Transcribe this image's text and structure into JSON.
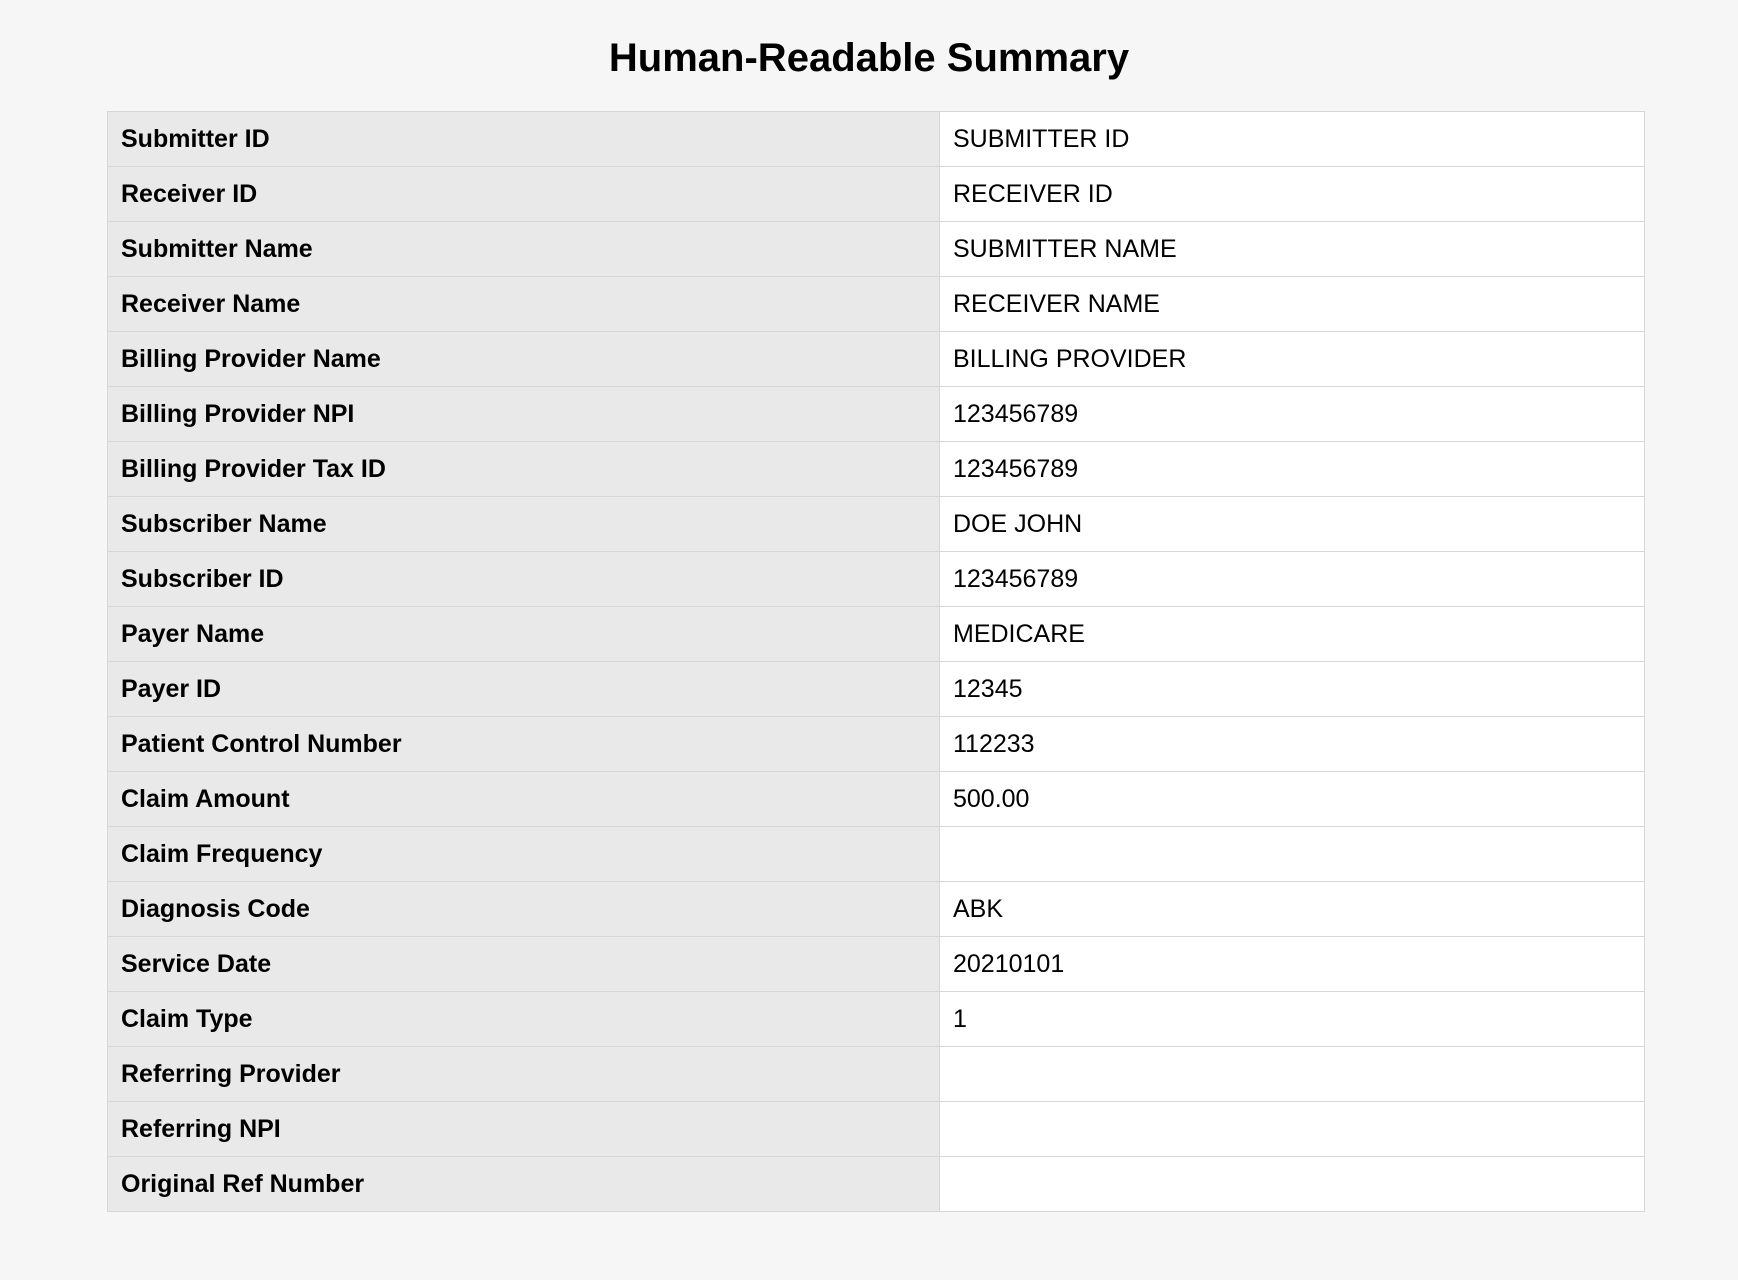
{
  "page": {
    "title": "Human-Readable Summary"
  },
  "colors": {
    "page_background": "#f6f6f6",
    "label_cell_background": "#e9e9e9",
    "value_cell_background": "#ffffff",
    "border": "#d6d6d6"
  },
  "summary": {
    "rows": [
      {
        "label": "Submitter ID",
        "value": "SUBMITTER ID"
      },
      {
        "label": "Receiver ID",
        "value": "RECEIVER ID"
      },
      {
        "label": "Submitter Name",
        "value": "SUBMITTER NAME"
      },
      {
        "label": "Receiver Name",
        "value": "RECEIVER NAME"
      },
      {
        "label": "Billing Provider Name",
        "value": "BILLING PROVIDER"
      },
      {
        "label": "Billing Provider NPI",
        "value": "123456789"
      },
      {
        "label": "Billing Provider Tax ID",
        "value": "123456789"
      },
      {
        "label": "Subscriber Name",
        "value": "DOE JOHN"
      },
      {
        "label": "Subscriber ID",
        "value": "123456789"
      },
      {
        "label": "Payer Name",
        "value": "MEDICARE"
      },
      {
        "label": "Payer ID",
        "value": "12345"
      },
      {
        "label": "Patient Control Number",
        "value": "112233"
      },
      {
        "label": "Claim Amount",
        "value": "500.00"
      },
      {
        "label": "Claim Frequency",
        "value": ""
      },
      {
        "label": "Diagnosis Code",
        "value": "ABK"
      },
      {
        "label": "Service Date",
        "value": "20210101"
      },
      {
        "label": "Claim Type",
        "value": "1"
      },
      {
        "label": "Referring Provider",
        "value": ""
      },
      {
        "label": "Referring NPI",
        "value": ""
      },
      {
        "label": "Original Ref Number",
        "value": ""
      }
    ]
  }
}
